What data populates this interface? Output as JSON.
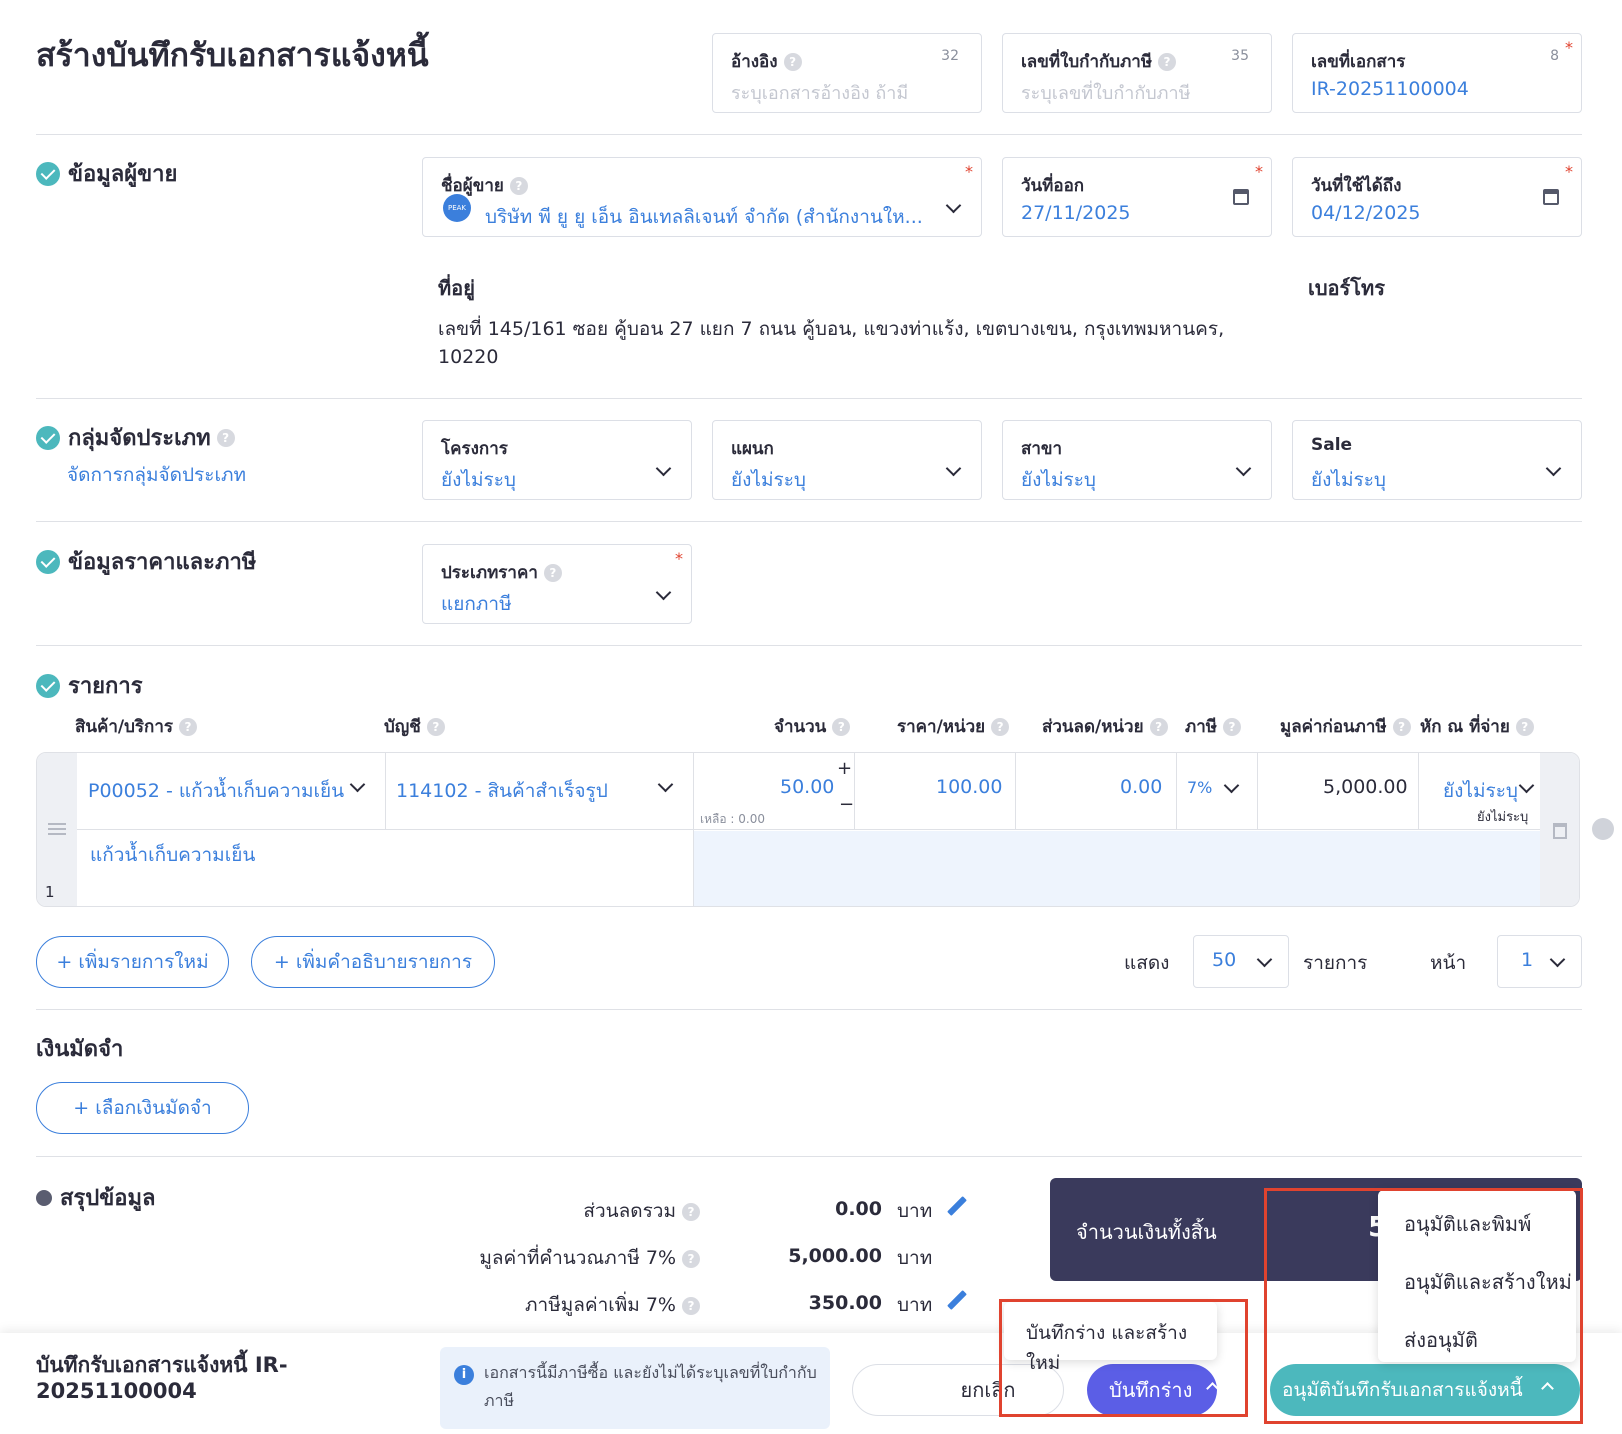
{
  "page_title": "สร้างบันทึกรับเอกสารแจ้งหนี้",
  "header_fields": {
    "reference": {
      "label": "อ้างอิง",
      "placeholder": "ระบุเอกสารอ้างอิง ถ้ามี",
      "counter": "32"
    },
    "tax_invoice_no": {
      "label": "เลขที่ใบกำกับภาษี",
      "placeholder": "ระบุเลขที่ใบกำกับภาษี",
      "counter": "35"
    },
    "document_no": {
      "label": "เลขที่เอกสาร",
      "value": "IR-20251100004",
      "counter": "8"
    }
  },
  "seller_section": {
    "title": "ข้อมูลผู้ขาย",
    "seller_name": {
      "label": "ชื่อผู้ขาย",
      "value": "บริษัท พี ยู ยู เอ็น อินเทลลิเจนท์ จำกัด (สำนักงานให...",
      "avatar_text": "PEAK"
    },
    "issue_date": {
      "label": "วันที่ออก",
      "value": "27/11/2025"
    },
    "valid_until": {
      "label": "วันที่ใช้ได้ถึง",
      "value": "04/12/2025"
    },
    "address_label": "ที่อยู่",
    "address_line1": "เลขที่ 145/161 ซอย คู้บอน 27 แยก 7 ถนน คู้บอน, แขวงท่าแร้ง, เขตบางเขน, กรุงเทพมหานคร,",
    "address_line2": "10220",
    "phone_label": "เบอร์โทร"
  },
  "category_section": {
    "title": "กลุ่มจัดประเภท",
    "manage_link": "จัดการกลุ่มจัดประเภท",
    "fields": [
      {
        "label": "โครงการ",
        "value": "ยังไม่ระบุ"
      },
      {
        "label": "แผนก",
        "value": "ยังไม่ระบุ"
      },
      {
        "label": "สาขา",
        "value": "ยังไม่ระบุ"
      },
      {
        "label": "Sale",
        "value": "ยังไม่ระบุ"
      }
    ]
  },
  "price_section": {
    "title": "ข้อมูลราคาและภาษี",
    "price_type": {
      "label": "ประเภทราคา",
      "value": "แยกภาษี"
    }
  },
  "items_section": {
    "title": "รายการ",
    "columns": [
      "สินค้า/บริการ",
      "บัญชี",
      "จำนวน",
      "ราคา/หน่วย",
      "ส่วนลด/หน่วย",
      "ภาษี",
      "มูลค่าก่อนภาษี",
      "หัก ณ ที่จ่าย"
    ],
    "rows": [
      {
        "index": "1",
        "product": "P00052 - แก้วน้ำเก็บความเย็น",
        "account": "114102 - สินค้าสำเร็จรูป",
        "quantity": "50.00",
        "remaining": "เหลือ : 0.00",
        "unit_price": "100.00",
        "discount": "0.00",
        "tax": "7%",
        "pre_tax": "5,000.00",
        "withholding": "ยังไม่ระบุ",
        "withholding_sub": "ยังไม่ระบุ",
        "description": "แก้วน้ำเก็บความเย็น"
      }
    ],
    "add_item_button": "+ เพิ่มรายการใหม่",
    "add_desc_button": "+ เพิ่มคำอธิบายรายการ",
    "show_label": "แสดง",
    "per_page": "50",
    "items_label": "รายการ",
    "page_label": "หน้า",
    "page": "1"
  },
  "deposit_section": {
    "title": "เงินมัดจำ",
    "select_button": "+ เลือกเงินมัดจำ"
  },
  "summary_section": {
    "title": "สรุปข้อมูล",
    "rows": [
      {
        "label": "ส่วนลดรวม",
        "value": "0.00",
        "unit": "บาท"
      },
      {
        "label": "มูลค่าที่คำนวณภาษี 7%",
        "value": "5,000.00",
        "unit": "บาท"
      },
      {
        "label": "ภาษีมูลค่าเพิ่ม 7%",
        "value": "350.00",
        "unit": "บาท"
      }
    ],
    "total_label": "จำนวนเงินทั้งสิ้น",
    "total_partial": "5"
  },
  "approve_menu": {
    "items": [
      "อนุมัติและพิมพ์",
      "อนุมัติและสร้างใหม่",
      "ส่งอนุมัติ"
    ]
  },
  "draft_menu": {
    "items": [
      "บันทึกร่าง และสร้างใหม่"
    ]
  },
  "footer": {
    "doc_title_line1": "บันทึกรับเอกสารแจ้งหนี้ IR-",
    "doc_title_line2": "20251100004",
    "info_text_line1": "เอกสารนี้มีภาษีซื้อ และยังไม่ได้ระบุเลขที่ใบกำกับ",
    "info_text_line2": "ภาษี",
    "cancel_button": "ยกเลิก",
    "save_draft_button": "บันทึกร่าง",
    "approve_button": "อนุมัติบันทึกรับเอกสารแจ้งหนี้"
  },
  "colors": {
    "accent_blue": "#3b7fdc",
    "teal": "#4cb8bd",
    "purple": "#5b5ee6",
    "navy": "#3a3a5c",
    "highlight_red": "#e0432f"
  }
}
